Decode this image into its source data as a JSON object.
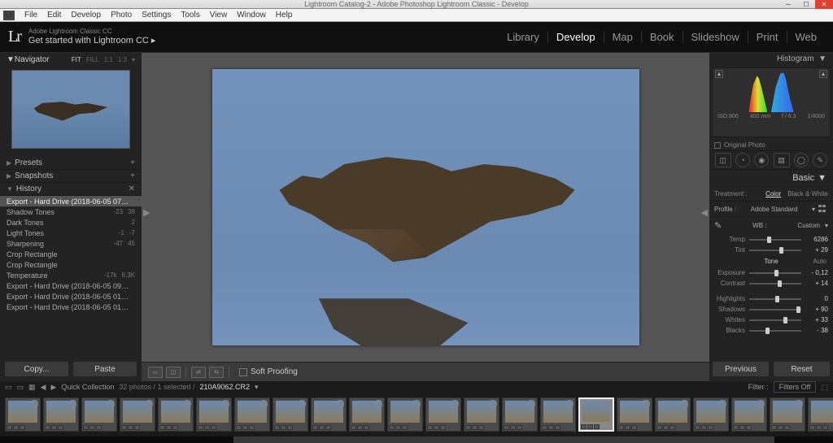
{
  "titlebar": "Lightroom Catalog-2 - Adobe Photoshop Lightroom Classic - Develop",
  "menubar": [
    "File",
    "Edit",
    "Develop",
    "Photo",
    "Settings",
    "Tools",
    "View",
    "Window",
    "Help"
  ],
  "logo_sub": "Adobe Lightroom Classic CC",
  "logo_main": "Get started with Lightroom CC  ▸",
  "modules": [
    "Library",
    "Develop",
    "Map",
    "Book",
    "Slideshow",
    "Print",
    "Web"
  ],
  "active_module": "Develop",
  "navigator": {
    "title": "Navigator",
    "modes": [
      "FIT",
      "FILL",
      "1:1",
      "1:3"
    ],
    "mode_sel": "FIT"
  },
  "panels": {
    "presets": "Presets",
    "snapshots": "Snapshots",
    "history": "History"
  },
  "history": [
    {
      "label": "Export - Hard Drive (2018-06-05 07:46:...",
      "v1": "",
      "v2": ""
    },
    {
      "label": "Shadow Tones",
      "v1": "-23",
      "v2": "38"
    },
    {
      "label": "Dark Tones",
      "v1": "",
      "v2": "2"
    },
    {
      "label": "Light Tones",
      "v1": "-1",
      "v2": "-7"
    },
    {
      "label": "Sharpening",
      "v1": "-47",
      "v2": "45"
    },
    {
      "label": "Crop Rectangle",
      "v1": "",
      "v2": ""
    },
    {
      "label": "Crop Rectangle",
      "v1": "",
      "v2": ""
    },
    {
      "label": "Temperature",
      "v1": "-17k",
      "v2": "6.3K"
    },
    {
      "label": "Export - Hard Drive (2018-06-05 09:10:...",
      "v1": "",
      "v2": ""
    },
    {
      "label": "Export - Hard Drive (2018-06-05 01:09:...",
      "v1": "",
      "v2": ""
    },
    {
      "label": "Export - Hard Drive (2018-06-05 01:08:...",
      "v1": "",
      "v2": ""
    }
  ],
  "copy": "Copy...",
  "paste": "Paste",
  "soft_proof": "Soft Proofing",
  "histogram": {
    "title": "Histogram",
    "iso": "ISO 800",
    "focal": "400 mm",
    "aperture": "f / 6.3",
    "shutter": "1/4000",
    "orig": "Original Photo"
  },
  "basic": {
    "title": "Basic",
    "treatment": "Treatment :",
    "color": "Color",
    "bw": "Black & White",
    "profile_lbl": "Profile :",
    "profile": "Adobe Standard",
    "wb_lbl": "WB :",
    "wb": "Custom",
    "temp_lbl": "Temp",
    "temp": "6286",
    "tint_lbl": "Tint",
    "tint": "+ 29",
    "tone": "Tone",
    "auto": "Auto",
    "exposure_lbl": "Exposure",
    "exposure": "- 0,12",
    "contrast_lbl": "Contrast",
    "contrast": "+ 14",
    "highlights_lbl": "Highlights",
    "highlights": "0",
    "shadows_lbl": "Shadows",
    "shadows": "+ 90",
    "whites_lbl": "Whites",
    "whites": "+ 33",
    "blacks_lbl": "Blacks",
    "blacks": "- 38"
  },
  "previous": "Previous",
  "reset": "Reset",
  "filmstrip": {
    "collection": "Quick Collection",
    "count": "32 photos / 1 selected /",
    "file": "210A9062.CR2",
    "filter_lbl": "Filter :",
    "filter": "Filters Off"
  },
  "thumb_count": 22
}
